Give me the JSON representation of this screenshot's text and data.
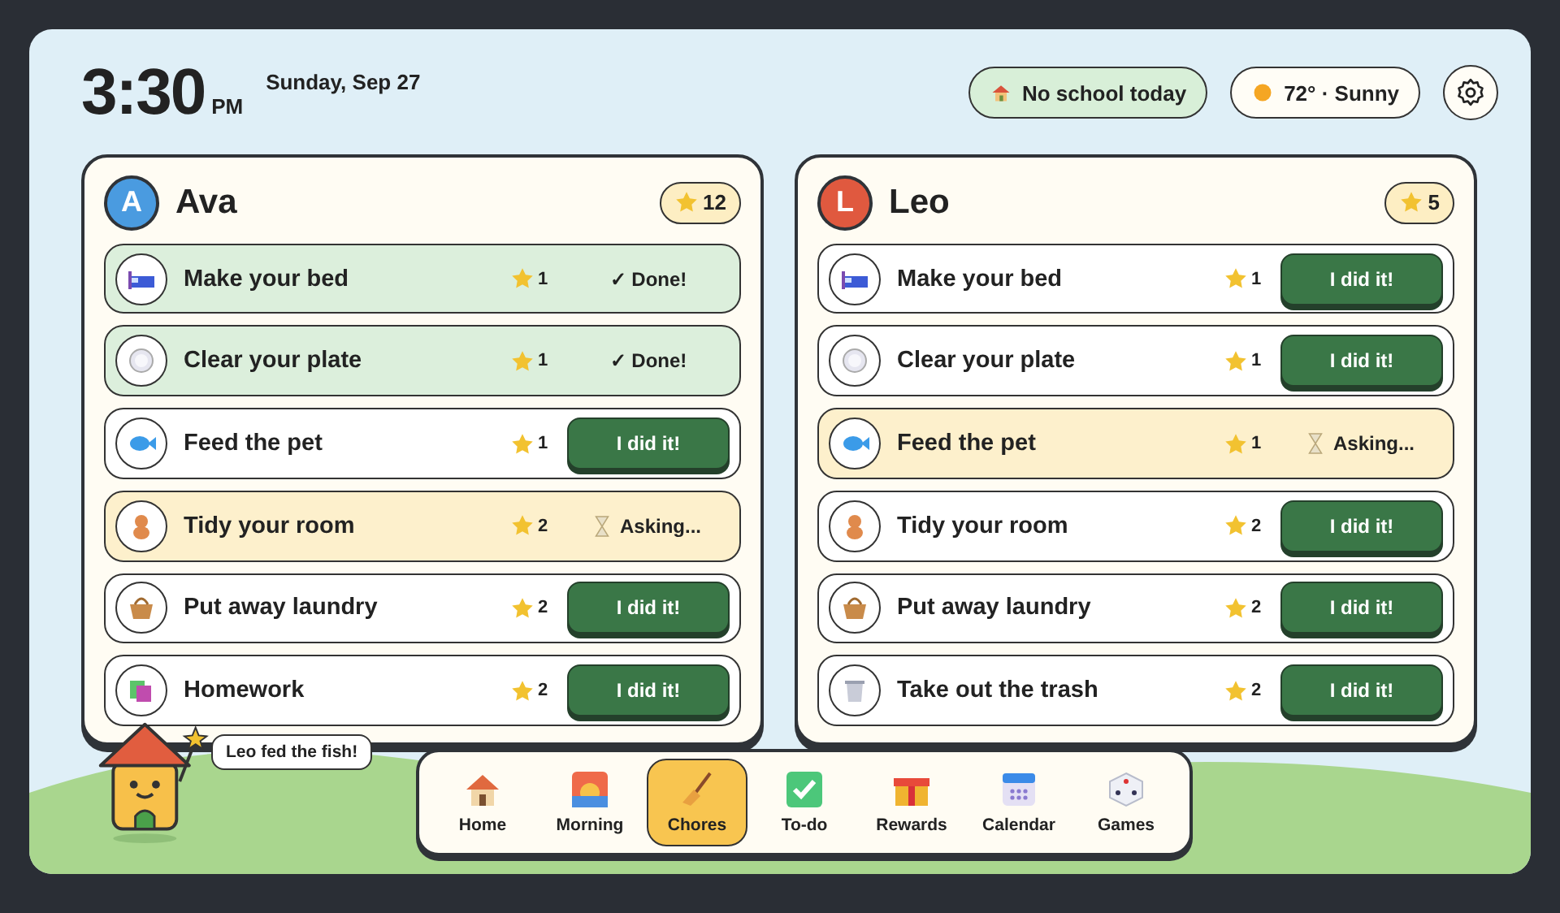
{
  "clock": {
    "time": "3:30",
    "meridiem": "PM",
    "date": "Sunday, Sep 27"
  },
  "status_pills": [
    {
      "kind": "school",
      "label": "No school today"
    },
    {
      "kind": "weather",
      "label": "72° · Sunny"
    }
  ],
  "kids": [
    {
      "initial": "A",
      "name": "Ava",
      "color": "#4a9be0",
      "stars": "12",
      "chores": [
        {
          "name": "Make your bed",
          "points": "1",
          "kind": "done",
          "status": "✓ Done!"
        },
        {
          "name": "Clear your plate",
          "points": "1",
          "kind": "done",
          "status": "✓ Done!"
        },
        {
          "name": "Feed the pet",
          "points": "1",
          "kind": "todo",
          "status": "I did it!"
        },
        {
          "name": "Tidy your room",
          "points": "2",
          "kind": "asking",
          "status": "Asking..."
        },
        {
          "name": "Put away laundry",
          "points": "2",
          "kind": "todo",
          "status": "I did it!"
        },
        {
          "name": "Homework",
          "points": "2",
          "kind": "todo",
          "status": "I did it!"
        }
      ]
    },
    {
      "initial": "L",
      "name": "Leo",
      "color": "#e0593f",
      "stars": "5",
      "chores": [
        {
          "name": "Make your bed",
          "points": "1",
          "kind": "todo",
          "status": "I did it!"
        },
        {
          "name": "Clear your plate",
          "points": "1",
          "kind": "todo",
          "status": "I did it!"
        },
        {
          "name": "Feed the pet",
          "points": "1",
          "kind": "asking",
          "status": "Asking..."
        },
        {
          "name": "Tidy your room",
          "points": "2",
          "kind": "todo",
          "status": "I did it!"
        },
        {
          "name": "Put away laundry",
          "points": "2",
          "kind": "todo",
          "status": "I did it!"
        },
        {
          "name": "Take out the trash",
          "points": "2",
          "kind": "todo",
          "status": "I did it!"
        }
      ]
    }
  ],
  "mascot": {
    "message": "Leo fed the fish!"
  },
  "nav": [
    {
      "label": "Home",
      "selected": false
    },
    {
      "label": "Morning",
      "selected": false
    },
    {
      "label": "Chores",
      "selected": true
    },
    {
      "label": "To-do",
      "selected": false
    },
    {
      "label": "Rewards",
      "selected": false
    },
    {
      "label": "Calendar",
      "selected": false
    },
    {
      "label": "Games",
      "selected": false
    }
  ]
}
